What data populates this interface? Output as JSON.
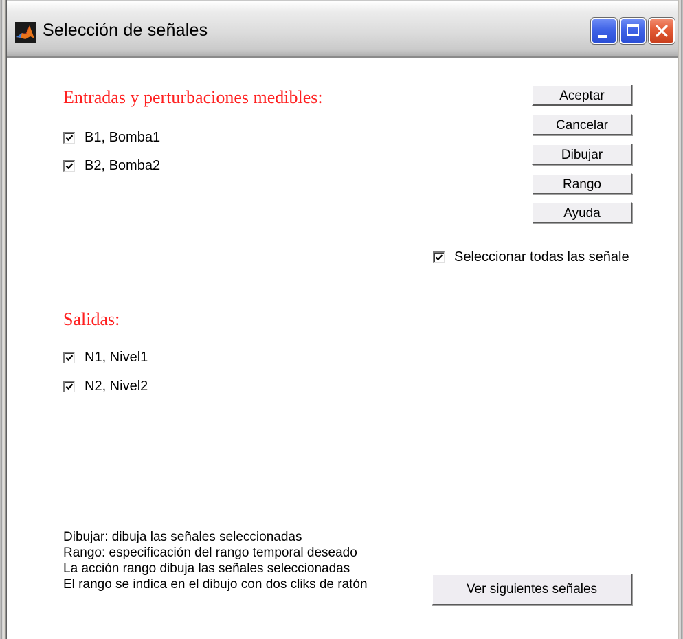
{
  "window": {
    "title": "Selección de señales",
    "icon": "matlab-icon",
    "controls": [
      "minimize-icon",
      "maximize-icon",
      "close-icon"
    ]
  },
  "inputs": {
    "heading": "Entradas y perturbaciones medibles:",
    "items": [
      {
        "label": "B1, Bomba1",
        "checked": true
      },
      {
        "label": "B2, Bomba2",
        "checked": true
      }
    ]
  },
  "outputs": {
    "heading": "Salidas:",
    "items": [
      {
        "label": "N1, Nivel1",
        "checked": true
      },
      {
        "label": "N2, Nivel2",
        "checked": true
      }
    ]
  },
  "actions": {
    "accept": "Aceptar",
    "cancel": "Cancelar",
    "draw": "Dibujar",
    "range": "Rango",
    "help": "Ayuda"
  },
  "select_all": {
    "label": "Seleccionar todas las señales",
    "checked": true
  },
  "help_text": [
    "Dibujar: dibuja las señales seleccionadas",
    "Rango: especificación del rango temporal deseado",
    "La acción rango dibuja las señales seleccionadas",
    "El rango se indica en el dibujo con dos cliks de ratón"
  ],
  "next_button": "Ver siguientes señales"
}
